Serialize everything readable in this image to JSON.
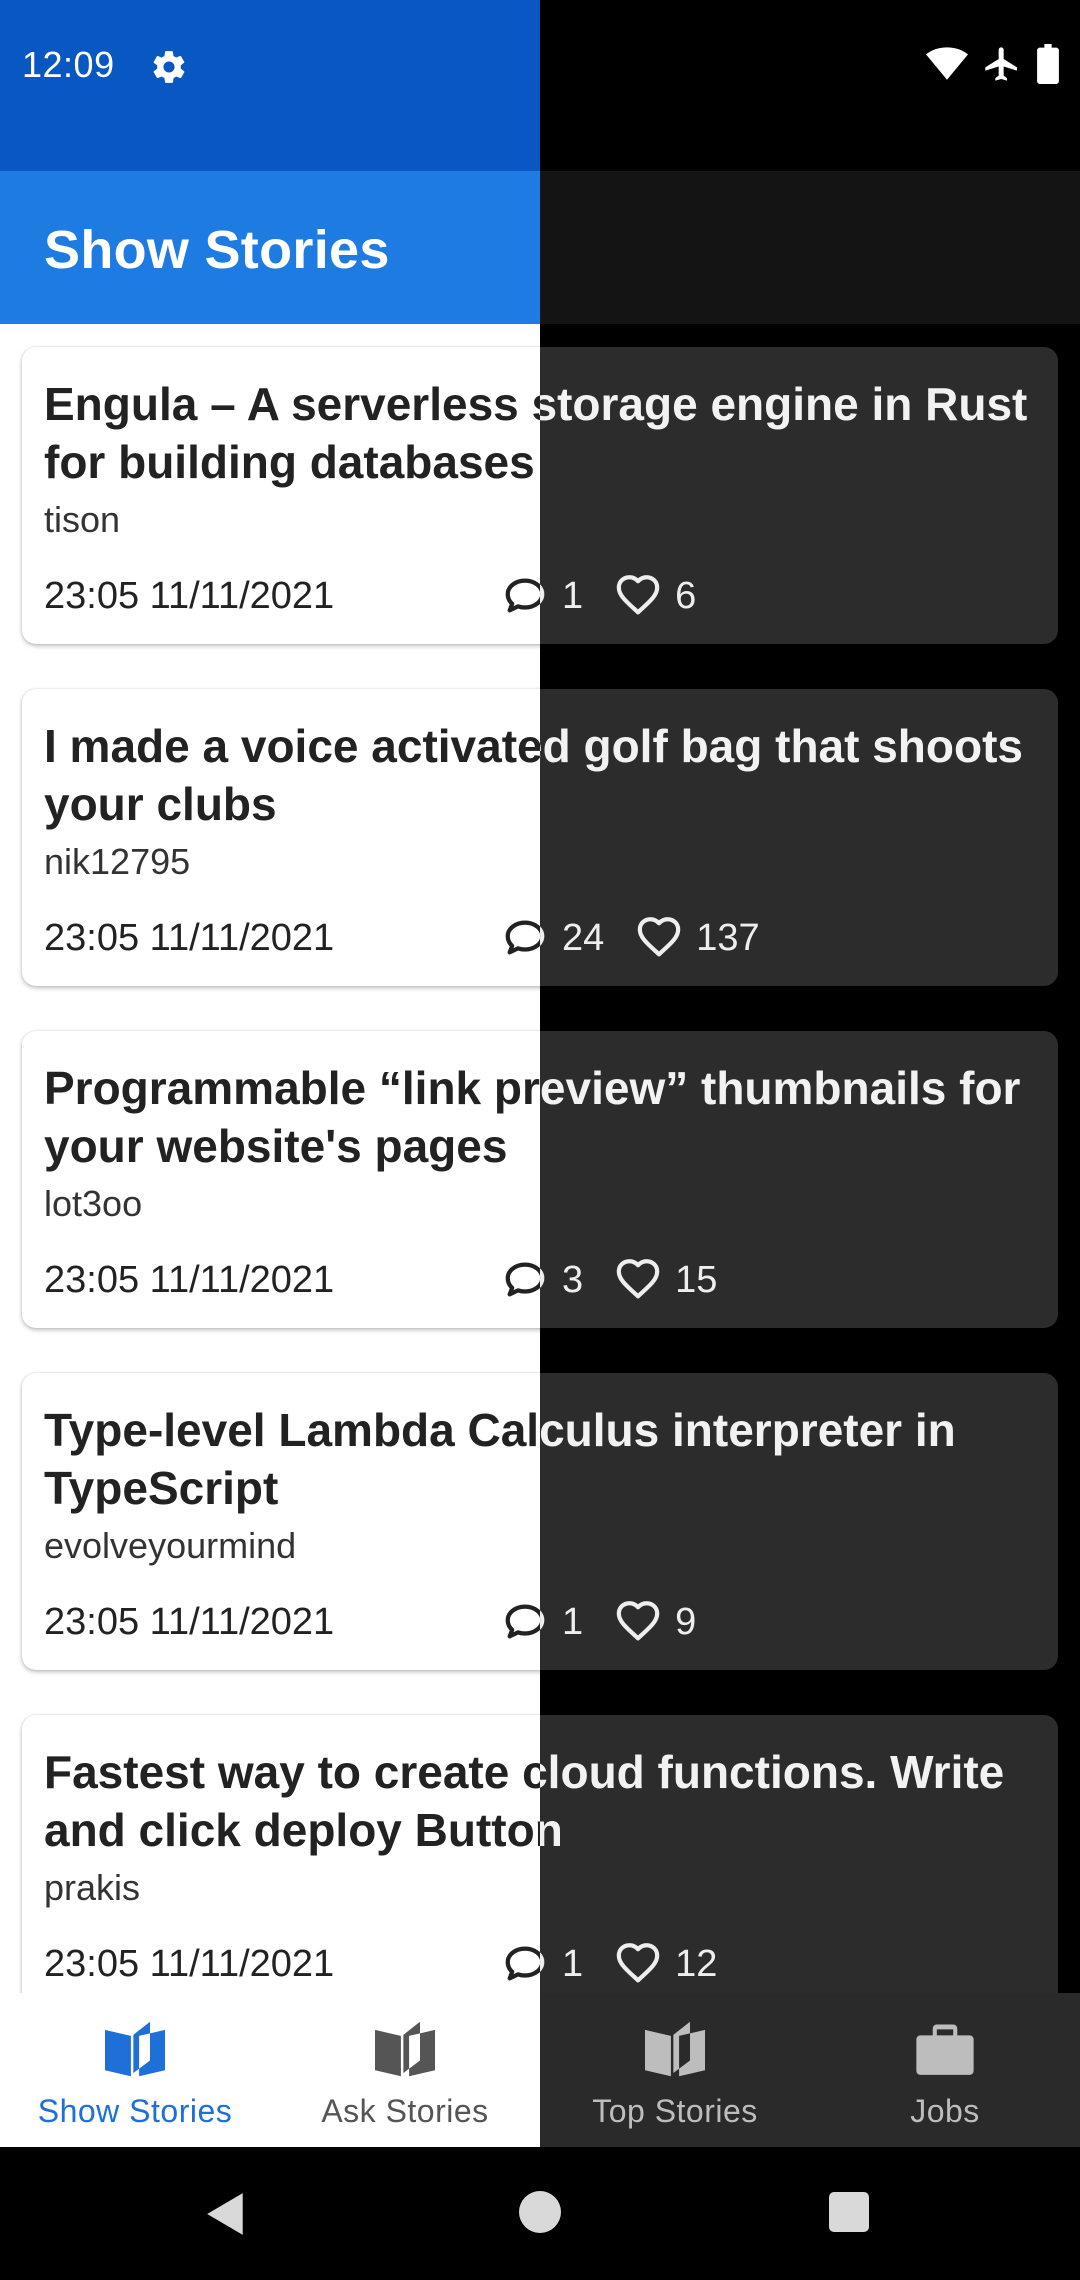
{
  "status": {
    "time": "12:09",
    "settings_icon": "gear-icon",
    "right_icons": [
      "wifi-icon",
      "airplane-icon",
      "battery-icon"
    ]
  },
  "appbar": {
    "title": "Show Stories"
  },
  "stories": [
    {
      "title": "Engula – A serverless storage engine in Rust for building databases",
      "author": "tison",
      "time": "23:05 11/11/2021",
      "comments": "1",
      "likes": "6"
    },
    {
      "title": "I made a voice activated golf bag that shoots your clubs",
      "author": "nik12795",
      "time": "23:05 11/11/2021",
      "comments": "24",
      "likes": "137"
    },
    {
      "title": "Programmable “link preview” thumbnails for your website's pages",
      "author": "lot3oo",
      "time": "23:05 11/11/2021",
      "comments": "3",
      "likes": "15"
    },
    {
      "title": "Type-level Lambda Calculus interpreter in TypeScript",
      "author": "evolveyourmind",
      "time": "23:05 11/11/2021",
      "comments": "1",
      "likes": "9"
    },
    {
      "title": "Fastest way to create cloud functions. Write and click deploy Button",
      "author": "prakis",
      "time": "23:05 11/11/2021",
      "comments": "1",
      "likes": "12"
    }
  ],
  "bottom_nav": {
    "active": "Show Stories",
    "items": [
      {
        "label": "Show Stories",
        "icon": "book-open-icon"
      },
      {
        "label": "Ask Stories",
        "icon": "book-open-icon"
      },
      {
        "label": "Top Stories",
        "icon": "book-open-icon"
      },
      {
        "label": "Jobs",
        "icon": "briefcase-icon"
      }
    ]
  },
  "colors": {
    "status_bar_light": "#0857c3",
    "app_bar_light": "#1e7be1",
    "accent": "#1e6fd8",
    "card_dark": "#2c2c2c",
    "app_bar_dark": "#141414",
    "nav_dark": "#2a2a2a"
  }
}
